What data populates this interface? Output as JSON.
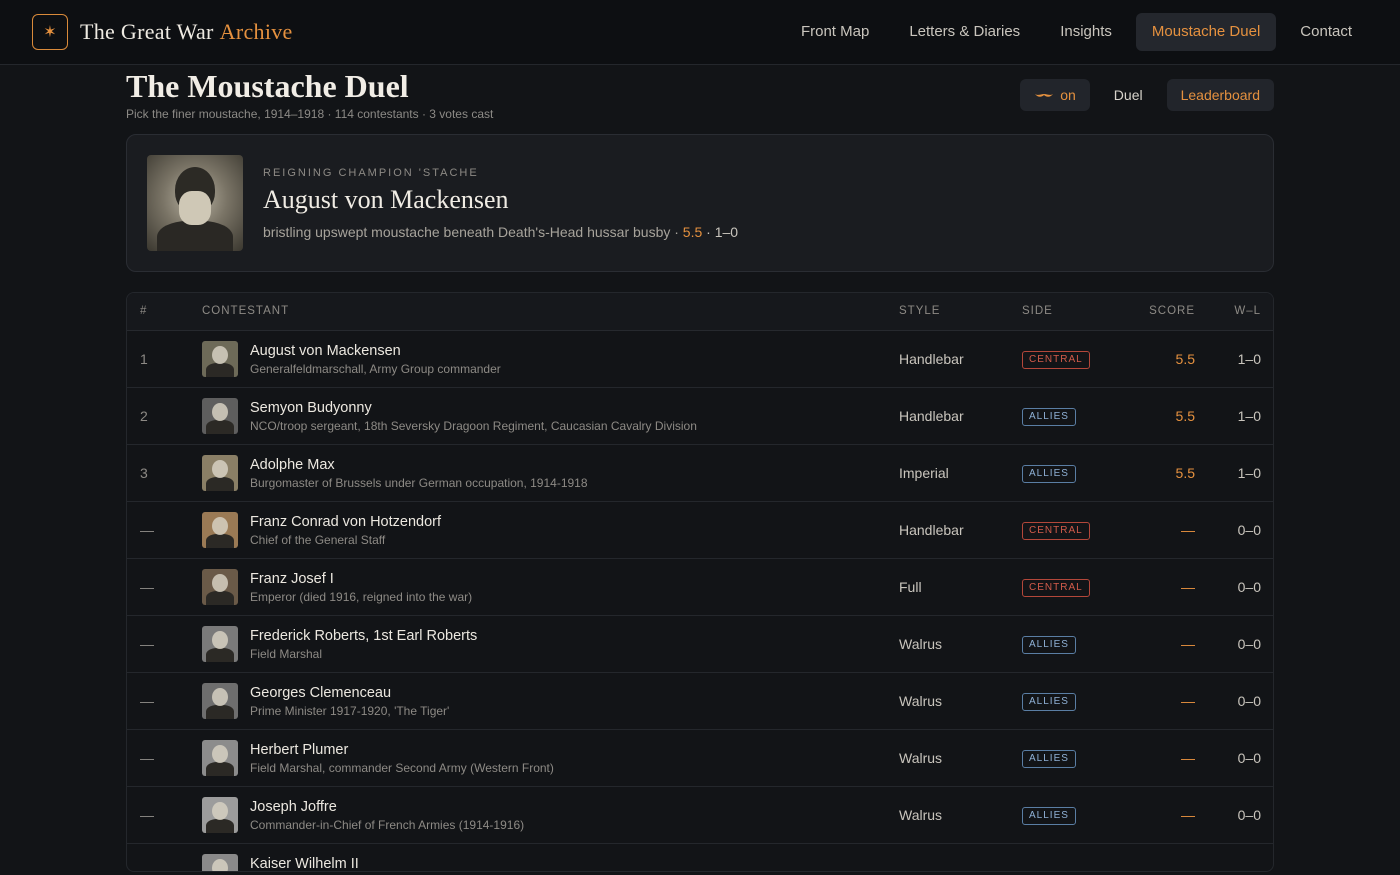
{
  "brand": {
    "mark": "✶",
    "title": "The Great War",
    "accent": "Archive"
  },
  "nav": [
    {
      "label": "Front Map",
      "active": false
    },
    {
      "label": "Letters & Diaries",
      "active": false
    },
    {
      "label": "Insights",
      "active": false
    },
    {
      "label": "Moustache Duel",
      "active": true
    },
    {
      "label": "Contact",
      "active": false
    }
  ],
  "page": {
    "title": "The Moustache Duel",
    "subtitle": "Pick the finer moustache, 1914–1918 · 114 contestants · 3 votes cast"
  },
  "toggles": {
    "moustache_mode": "on",
    "duel": "Duel",
    "leaderboard": "Leaderboard"
  },
  "champion": {
    "kicker": "REIGNING CHAMPION 'STACHE",
    "name": "August von Mackensen",
    "description": "bristling upswept moustache beneath Death's-Head hussar busby · ",
    "score": "5.5",
    "record": " · 1–0"
  },
  "table": {
    "headers": {
      "rank": "#",
      "contestant": "CONTESTANT",
      "style": "STYLE",
      "side": "SIDE",
      "score": "SCORE",
      "wl": "W–L"
    },
    "rows": [
      {
        "rank": "1",
        "name": "August von Mackensen",
        "sub": "Generalfeldmarschall, Army Group commander",
        "style": "Handlebar",
        "side": "CENTRAL",
        "score": "5.5",
        "wl": "1–0",
        "tone": "#6d6a58"
      },
      {
        "rank": "2",
        "name": "Semyon Budyonny",
        "sub": "NCO/troop sergeant, 18th Seversky Dragoon Regiment, Caucasian Cavalry Division",
        "style": "Handlebar",
        "side": "ALLIES",
        "score": "5.5",
        "wl": "1–0",
        "tone": "#5e5e5e"
      },
      {
        "rank": "3",
        "name": "Adolphe Max",
        "sub": "Burgomaster of Brussels under German occupation, 1914-1918",
        "style": "Imperial",
        "side": "ALLIES",
        "score": "5.5",
        "wl": "1–0",
        "tone": "#8a7f66"
      },
      {
        "rank": "—",
        "name": "Franz Conrad von Hotzendorf",
        "sub": "Chief of the General Staff",
        "style": "Handlebar",
        "side": "CENTRAL",
        "score": "—",
        "wl": "0–0",
        "tone": "#9a7a55"
      },
      {
        "rank": "—",
        "name": "Franz Josef I",
        "sub": "Emperor (died 1916, reigned into the war)",
        "style": "Full",
        "side": "CENTRAL",
        "score": "—",
        "wl": "0–0",
        "tone": "#6a5a48"
      },
      {
        "rank": "—",
        "name": "Frederick Roberts, 1st Earl Roberts",
        "sub": "Field Marshal",
        "style": "Walrus",
        "side": "ALLIES",
        "score": "—",
        "wl": "0–0",
        "tone": "#7a7a7a"
      },
      {
        "rank": "—",
        "name": "Georges Clemenceau",
        "sub": "Prime Minister 1917-1920, 'The Tiger'",
        "style": "Walrus",
        "side": "ALLIES",
        "score": "—",
        "wl": "0–0",
        "tone": "#6e6e6e"
      },
      {
        "rank": "—",
        "name": "Herbert Plumer",
        "sub": "Field Marshal, commander Second Army (Western Front)",
        "style": "Walrus",
        "side": "ALLIES",
        "score": "—",
        "wl": "0–0",
        "tone": "#8c8c8c"
      },
      {
        "rank": "—",
        "name": "Joseph Joffre",
        "sub": "Commander-in-Chief of French Armies (1914-1916)",
        "style": "Walrus",
        "side": "ALLIES",
        "score": "—",
        "wl": "0–0",
        "tone": "#9c9c9c"
      },
      {
        "rank": "—",
        "name": "Kaiser Wilhelm II",
        "sub": "",
        "style": "",
        "side": "",
        "score": "",
        "wl": "",
        "tone": "#8a8a8a"
      }
    ]
  },
  "colors": {
    "accent": "#e5913f",
    "central": "#d25b4a",
    "allies": "#8fb1d6",
    "background": "#121417"
  }
}
